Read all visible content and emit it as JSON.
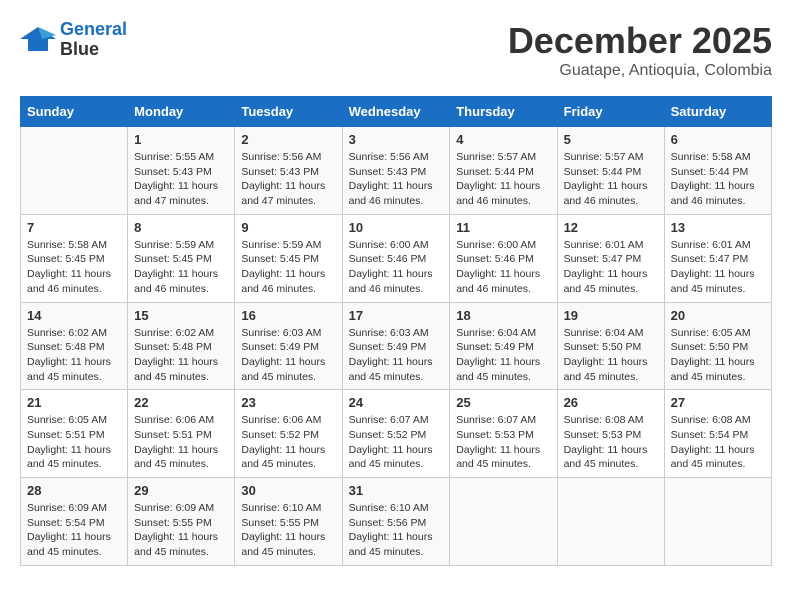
{
  "logo": {
    "line1": "General",
    "line2": "Blue"
  },
  "title": "December 2025",
  "subtitle": "Guatape, Antioquia, Colombia",
  "days_of_week": [
    "Sunday",
    "Monday",
    "Tuesday",
    "Wednesday",
    "Thursday",
    "Friday",
    "Saturday"
  ],
  "weeks": [
    [
      {
        "day": "",
        "info": ""
      },
      {
        "day": "1",
        "info": "Sunrise: 5:55 AM\nSunset: 5:43 PM\nDaylight: 11 hours\nand 47 minutes."
      },
      {
        "day": "2",
        "info": "Sunrise: 5:56 AM\nSunset: 5:43 PM\nDaylight: 11 hours\nand 47 minutes."
      },
      {
        "day": "3",
        "info": "Sunrise: 5:56 AM\nSunset: 5:43 PM\nDaylight: 11 hours\nand 46 minutes."
      },
      {
        "day": "4",
        "info": "Sunrise: 5:57 AM\nSunset: 5:44 PM\nDaylight: 11 hours\nand 46 minutes."
      },
      {
        "day": "5",
        "info": "Sunrise: 5:57 AM\nSunset: 5:44 PM\nDaylight: 11 hours\nand 46 minutes."
      },
      {
        "day": "6",
        "info": "Sunrise: 5:58 AM\nSunset: 5:44 PM\nDaylight: 11 hours\nand 46 minutes."
      }
    ],
    [
      {
        "day": "7",
        "info": "Sunrise: 5:58 AM\nSunset: 5:45 PM\nDaylight: 11 hours\nand 46 minutes."
      },
      {
        "day": "8",
        "info": "Sunrise: 5:59 AM\nSunset: 5:45 PM\nDaylight: 11 hours\nand 46 minutes."
      },
      {
        "day": "9",
        "info": "Sunrise: 5:59 AM\nSunset: 5:45 PM\nDaylight: 11 hours\nand 46 minutes."
      },
      {
        "day": "10",
        "info": "Sunrise: 6:00 AM\nSunset: 5:46 PM\nDaylight: 11 hours\nand 46 minutes."
      },
      {
        "day": "11",
        "info": "Sunrise: 6:00 AM\nSunset: 5:46 PM\nDaylight: 11 hours\nand 46 minutes."
      },
      {
        "day": "12",
        "info": "Sunrise: 6:01 AM\nSunset: 5:47 PM\nDaylight: 11 hours\nand 45 minutes."
      },
      {
        "day": "13",
        "info": "Sunrise: 6:01 AM\nSunset: 5:47 PM\nDaylight: 11 hours\nand 45 minutes."
      }
    ],
    [
      {
        "day": "14",
        "info": "Sunrise: 6:02 AM\nSunset: 5:48 PM\nDaylight: 11 hours\nand 45 minutes."
      },
      {
        "day": "15",
        "info": "Sunrise: 6:02 AM\nSunset: 5:48 PM\nDaylight: 11 hours\nand 45 minutes."
      },
      {
        "day": "16",
        "info": "Sunrise: 6:03 AM\nSunset: 5:49 PM\nDaylight: 11 hours\nand 45 minutes."
      },
      {
        "day": "17",
        "info": "Sunrise: 6:03 AM\nSunset: 5:49 PM\nDaylight: 11 hours\nand 45 minutes."
      },
      {
        "day": "18",
        "info": "Sunrise: 6:04 AM\nSunset: 5:49 PM\nDaylight: 11 hours\nand 45 minutes."
      },
      {
        "day": "19",
        "info": "Sunrise: 6:04 AM\nSunset: 5:50 PM\nDaylight: 11 hours\nand 45 minutes."
      },
      {
        "day": "20",
        "info": "Sunrise: 6:05 AM\nSunset: 5:50 PM\nDaylight: 11 hours\nand 45 minutes."
      }
    ],
    [
      {
        "day": "21",
        "info": "Sunrise: 6:05 AM\nSunset: 5:51 PM\nDaylight: 11 hours\nand 45 minutes."
      },
      {
        "day": "22",
        "info": "Sunrise: 6:06 AM\nSunset: 5:51 PM\nDaylight: 11 hours\nand 45 minutes."
      },
      {
        "day": "23",
        "info": "Sunrise: 6:06 AM\nSunset: 5:52 PM\nDaylight: 11 hours\nand 45 minutes."
      },
      {
        "day": "24",
        "info": "Sunrise: 6:07 AM\nSunset: 5:52 PM\nDaylight: 11 hours\nand 45 minutes."
      },
      {
        "day": "25",
        "info": "Sunrise: 6:07 AM\nSunset: 5:53 PM\nDaylight: 11 hours\nand 45 minutes."
      },
      {
        "day": "26",
        "info": "Sunrise: 6:08 AM\nSunset: 5:53 PM\nDaylight: 11 hours\nand 45 minutes."
      },
      {
        "day": "27",
        "info": "Sunrise: 6:08 AM\nSunset: 5:54 PM\nDaylight: 11 hours\nand 45 minutes."
      }
    ],
    [
      {
        "day": "28",
        "info": "Sunrise: 6:09 AM\nSunset: 5:54 PM\nDaylight: 11 hours\nand 45 minutes."
      },
      {
        "day": "29",
        "info": "Sunrise: 6:09 AM\nSunset: 5:55 PM\nDaylight: 11 hours\nand 45 minutes."
      },
      {
        "day": "30",
        "info": "Sunrise: 6:10 AM\nSunset: 5:55 PM\nDaylight: 11 hours\nand 45 minutes."
      },
      {
        "day": "31",
        "info": "Sunrise: 6:10 AM\nSunset: 5:56 PM\nDaylight: 11 hours\nand 45 minutes."
      },
      {
        "day": "",
        "info": ""
      },
      {
        "day": "",
        "info": ""
      },
      {
        "day": "",
        "info": ""
      }
    ]
  ]
}
